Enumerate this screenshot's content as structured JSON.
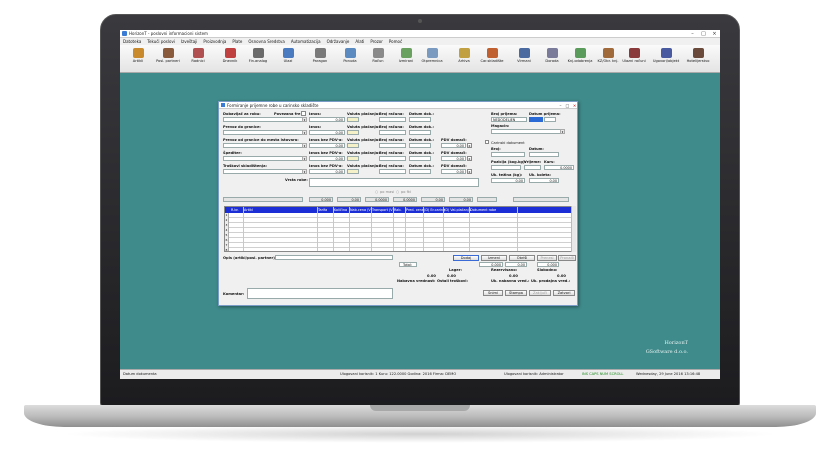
{
  "window": {
    "title": "HorizonT - poslovni informacioni sistem"
  },
  "menu": [
    "Datoteka",
    "Tekući poslovi",
    "Izveštaji",
    "Proizvodnja",
    "Plate",
    "Osnovna Sredstva",
    "Automatizacija",
    "Održavanje",
    "Alati",
    "Prozor",
    "Pomoć"
  ],
  "toolbar": [
    {
      "label": "Artikli",
      "icon": "box-icon",
      "color": "#c98a2e"
    },
    {
      "label": "Posl. partneri",
      "icon": "people-icon",
      "color": "#8a5a3c"
    },
    {
      "label": "Radnici",
      "icon": "worker-icon",
      "color": "#b05050"
    },
    {
      "label": "Dnevnik",
      "icon": "book-icon",
      "color": "#c04040"
    },
    {
      "label": "Fin.analog",
      "icon": "ledger-icon",
      "color": "#6a6a6a"
    },
    {
      "label": "Ulazi",
      "icon": "truck-icon",
      "color": "#4a7ac0"
    },
    {
      "label": "Paragon",
      "icon": "tag-icon",
      "color": "#7a7a7a"
    },
    {
      "label": "Ponuda",
      "icon": "document-icon",
      "color": "#5a8ac0"
    },
    {
      "label": "Račun",
      "icon": "invoice-icon",
      "color": "#8a8a8a"
    },
    {
      "label": "Izmirani",
      "icon": "cash-icon",
      "color": "#6aa060"
    },
    {
      "label": "Otpremnica",
      "icon": "shipping-icon",
      "color": "#7a9ac0"
    },
    {
      "label": "Arhiva",
      "icon": "archive-icon",
      "color": "#c0a040"
    },
    {
      "label": "Car.skladište",
      "icon": "warehouse-icon",
      "color": "#c06030"
    },
    {
      "label": "Virmani",
      "icon": "transfer-icon",
      "color": "#4a6aa0"
    },
    {
      "label": "Dorada",
      "icon": "gear-icon",
      "color": "#7a7a9a"
    },
    {
      "label": "Knj.odobrenja",
      "icon": "approve-icon",
      "color": "#5a9a5a"
    },
    {
      "label": "KZ/Obr. knj.",
      "icon": "table-icon",
      "color": "#a06a3a"
    },
    {
      "label": "Ulazni računi",
      "icon": "receipt-icon",
      "color": "#8a3a3a"
    },
    {
      "label": "Ugovori/objekt",
      "icon": "contract-icon",
      "color": "#4a5aa0"
    },
    {
      "label": "Hotelijerstvo",
      "icon": "hotel-icon",
      "color": "#6a4a3a"
    }
  ],
  "dialog": {
    "title": "Formiranje prijemne robe u carinsko skladište",
    "labels": {
      "dobavljac": "Dobavljač za robu:",
      "povezana": "Povezana fre",
      "iznos": "Iznos:",
      "valuta": "Valuta plaćanja:",
      "broj_racuna": "Broj računa:",
      "datum_dok": "Datum dok.:",
      "prevoz_granica": "Prevoz do granice:",
      "prevoz_mesta": "Prevoz od granice do mesta istovara:",
      "iznos_pdv": "Iznos bez PDV-a:",
      "pdv_domaci": "PDV domaći:",
      "spediter": "Špediter:",
      "troskovi": "Troškovi skladištenja:",
      "vrsta_robe": "Vrsta robe:",
      "broj_prijema": "Broj prijema:",
      "datum_prijema": "Datum prijema:",
      "nedodeljen": "NEDODELJEN",
      "magacin": "Magacin:",
      "carinski_dok": "Carinski dokument",
      "broj": "Broj:",
      "datum": "Datum:",
      "pozicija": "Pozicija (kog.kg):",
      "vrijeme": "Vrijeme:",
      "kurs": "Kurs:",
      "uk_tezina": "Uk. težina (kg):",
      "uk_koleta": "Uk. koleta:",
      "po_masi": "po masi",
      "po_fki": "po fki",
      "opis": "Opis (artikl/posl. partner):",
      "komentar": "Komentar:",
      "total": "Total:",
      "lager": "Lager:",
      "rezervisano": "Rezervisano:",
      "slobodno": "Slobodno:",
      "nabavna": "Nabavna vrednost:",
      "ostali": "Ostali troškovi:",
      "uk_nabavna": "Uk. nabavna vred.:",
      "uk_prodajna": "Uk. prodajna vred.:"
    },
    "values": {
      "zero": "0.00",
      "zero4": "0.0000",
      "zero_big": "0.000",
      "pdv_zero": "0.00",
      "kurs": "0.0000"
    },
    "grid_headers": [
      "R.br.",
      "Artikl",
      "Tarifa",
      "Količina",
      "Nab.cena (V)",
      "Transport (V)",
      "Rab.",
      "Pred. cena",
      "(D) Er.carine",
      "(D) Val.plaćanja",
      "Dokument robe"
    ],
    "grid_rows": [
      "1",
      "2",
      "3",
      "4",
      "5",
      "6",
      "7",
      "8"
    ],
    "buttons": {
      "dodaj": "Dodaj",
      "izmeni": "Izmeni",
      "obrisi": "Obriši",
      "prenesi": "Prenesi",
      "pronadji": "Pronađi",
      "snimi": "Snimi",
      "zatvori": "Zatvori",
      "stampa": "Štampa",
      "zakljuci": "Zaključi",
      "dokument": "Dokument"
    }
  },
  "brand": {
    "line1": "HorizonT",
    "line2": "GSoftware d.o.o."
  },
  "status": {
    "left": "Datum dokumenta",
    "mid": "Ulogovani korisnik: 1 Kuru: 122.0000  Godina: 2016  Firma: DEMO",
    "user": "Ulogovani korisnik: Administrator",
    "caps": "INS CAPS NUM SCROLL",
    "date": "Wednesday, 29 June 2016 13:16:48"
  }
}
